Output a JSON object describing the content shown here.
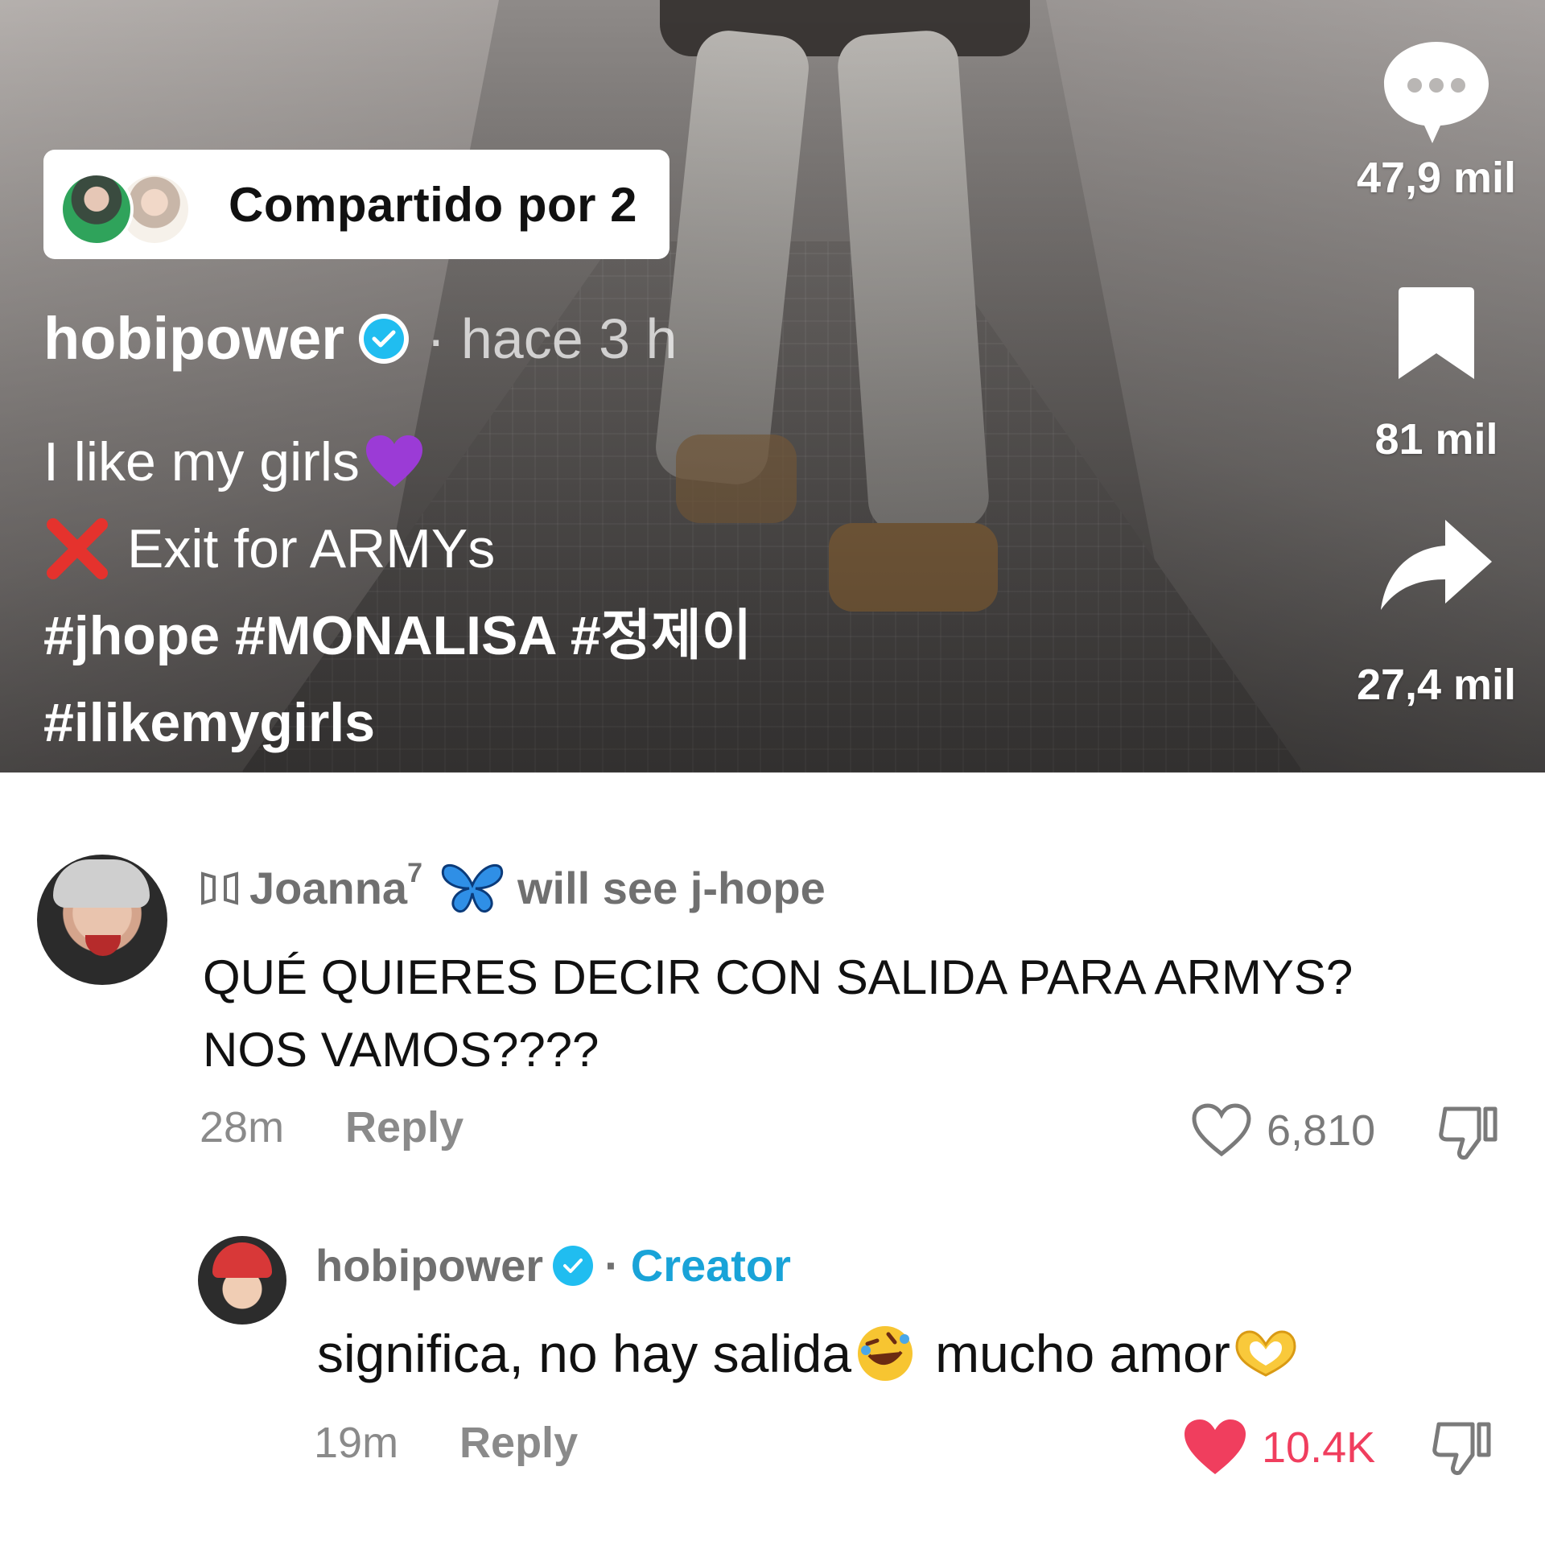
{
  "video": {
    "shared_label": "Compartido por 2",
    "author": "hobipower",
    "time": "· hace 3 h",
    "caption": {
      "line1": "I like my girls",
      "line2": "Exit for ARMYs",
      "line3": "#jhope #MONALISA #정제이",
      "line4": "#ilikemygirls"
    }
  },
  "actions": {
    "comments_count": "47,9 mil",
    "saves_count": "81 mil",
    "shares_count": "27,4 mil"
  },
  "comments": [
    {
      "username": "Joanna",
      "superscript": "7",
      "display_suffix": "will see j-hope",
      "text": "QUÉ QUIERES DECIR CON SALIDA PARA ARMYS? NOS VAMOS????",
      "time": "28m",
      "reply_label": "Reply",
      "likes": "6,810",
      "liked": false
    },
    {
      "username": "hobipower",
      "separator": "·",
      "badge": "Creator",
      "text_part1": "significa, no hay salida",
      "text_part2": "mucho amor",
      "time": "19m",
      "reply_label": "Reply",
      "likes": "10.4K",
      "liked": true
    }
  ],
  "colors": {
    "verified_blue": "#20bdf0",
    "creator_blue": "#19a3d8",
    "liked_red": "#f03e5e"
  },
  "icons": [
    "comment-bubble-icon",
    "bookmark-icon",
    "share-arrow-icon",
    "verified-icon",
    "heart-icon",
    "dislike-icon"
  ]
}
